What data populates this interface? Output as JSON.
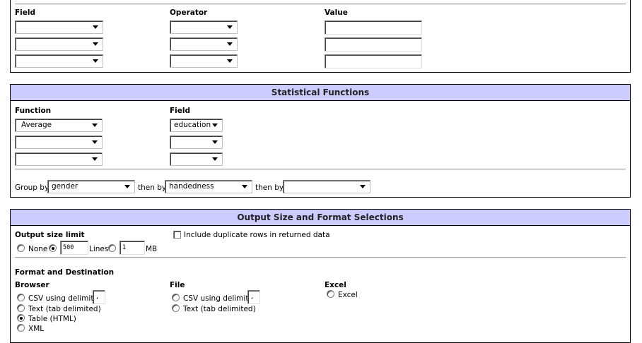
{
  "filter": {
    "headers": {
      "field": "Field",
      "operator": "Operator",
      "value": "Value"
    },
    "rows": [
      {
        "field": "",
        "operator": "",
        "value": ""
      },
      {
        "field": "",
        "operator": "",
        "value": ""
      },
      {
        "field": "",
        "operator": "",
        "value": ""
      }
    ]
  },
  "stats": {
    "title": "Statistical Functions",
    "headers": {
      "function": "Function",
      "field": "Field"
    },
    "rows": [
      {
        "function": "Average",
        "field": "education"
      },
      {
        "function": "",
        "field": ""
      },
      {
        "function": "",
        "field": ""
      }
    ],
    "group_by_label": "Group by",
    "group_by": "gender",
    "then_by_label_1": "then by",
    "then_by_1": "handedness",
    "then_by_label_2": "then by",
    "then_by_2": ""
  },
  "output": {
    "title": "Output Size and Format Selections",
    "size_limit_label": "Output size limit",
    "none_label": "None",
    "lines_value": "500",
    "lines_label": "Lines",
    "mb_value": "1",
    "mb_label": "MB",
    "selected_size": "lines",
    "include_duplicates_label": "Include duplicate rows in returned data",
    "include_duplicates": false,
    "format_label": "Format and Destination",
    "browser": {
      "label": "Browser",
      "csv_label": "CSV using delimiter",
      "delimiter": ",",
      "text_label": "Text (tab delimited)",
      "table_label": "Table (HTML)",
      "xml_label": "XML",
      "selected": "table"
    },
    "file": {
      "label": "File",
      "csv_label": "CSV using delimiter",
      "delimiter": ",",
      "text_label": "Text (tab delimited)"
    },
    "excel": {
      "label": "Excel",
      "option_label": "Excel"
    }
  }
}
